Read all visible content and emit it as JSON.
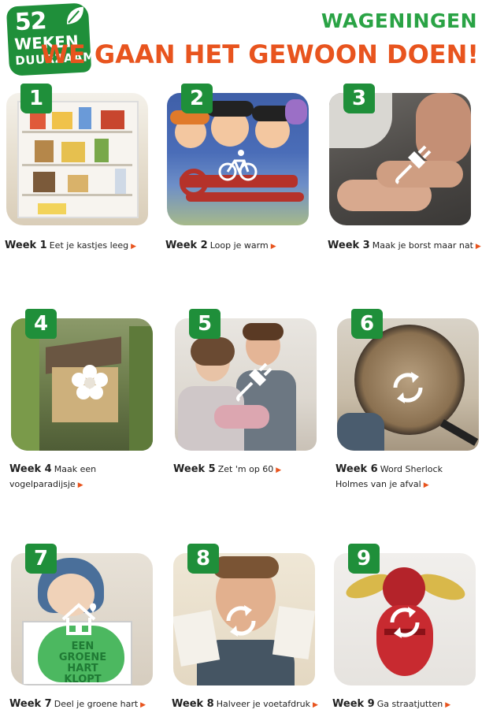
{
  "logo": {
    "number": "52",
    "line1": "WEKEN",
    "line2": "DUURZAAM"
  },
  "header": {
    "city": "WAGENINGEN",
    "tagline": "WE GAAN HET GEWOON DOEN!"
  },
  "colors": {
    "green": "#1f8f3a",
    "orange": "#e8541e"
  },
  "cards": [
    {
      "badge": "1",
      "week": "Week 1",
      "text": "Eet je kastjes leeg",
      "icon": "house-icon"
    },
    {
      "badge": "2",
      "week": "Week 2",
      "text": "Loop je warm",
      "icon": "bicycle-icon"
    },
    {
      "badge": "3",
      "week": "Week 3",
      "text": "Maak je borst maar nat",
      "icon": "plug-icon"
    },
    {
      "badge": "4",
      "week": "Week 4",
      "text": "Maak een vogelparadijsje",
      "icon": "flower-icon"
    },
    {
      "badge": "5",
      "week": "Week 5",
      "text": "Zet 'm op 60",
      "icon": "plug-icon"
    },
    {
      "badge": "6",
      "week": "Week 6",
      "text": "Word Sherlock Holmes van je afval",
      "icon": "recycle-icon"
    },
    {
      "badge": "7",
      "week": "Week 7",
      "text": "Deel je groene hart",
      "icon": "house-heart-icon"
    },
    {
      "badge": "8",
      "week": "Week 8",
      "text": "Halveer je voetafdruk",
      "icon": "recycle-icon"
    },
    {
      "badge": "9",
      "week": "Week 9",
      "text": "Ga straatjutten",
      "icon": "recycle-icon"
    }
  ],
  "photo_text": {
    "sign": "EEN GROENE HART KLOPT"
  }
}
